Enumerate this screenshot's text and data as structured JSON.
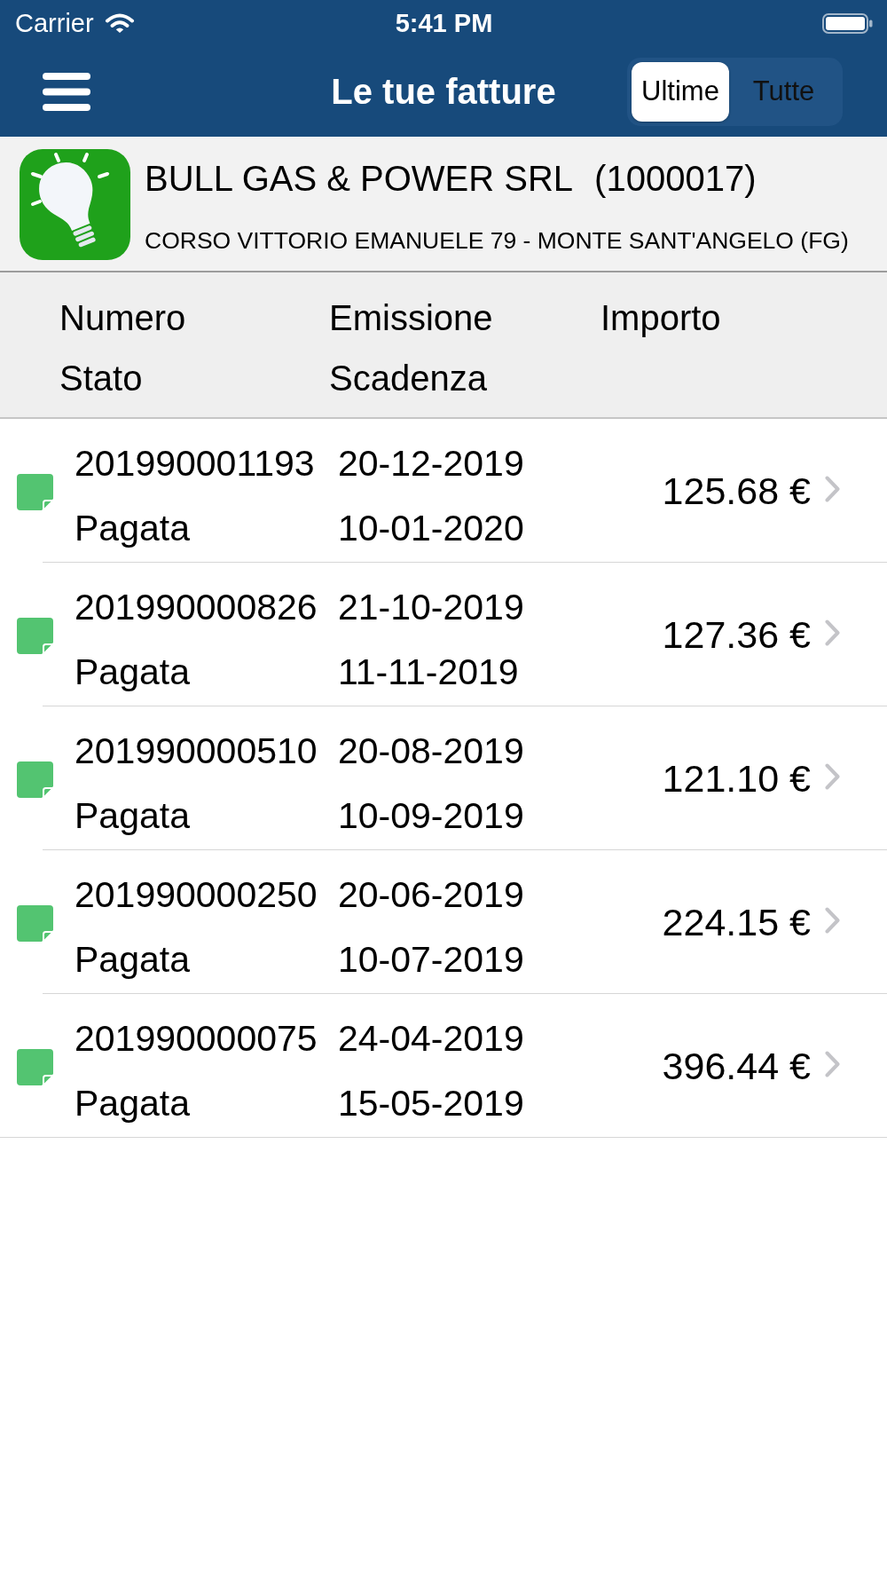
{
  "status_bar": {
    "carrier": "Carrier",
    "time": "5:41 PM"
  },
  "nav_bar": {
    "title": "Le tue fatture",
    "segments": [
      {
        "label": "Ultime",
        "selected": true
      },
      {
        "label": "Tutte",
        "selected": false
      }
    ]
  },
  "customer": {
    "name": "BULL GAS & POWER SRL",
    "code": "(1000017)",
    "address": "CORSO VITTORIO EMANUELE 79 - MONTE SANT'ANGELO (FG)"
  },
  "table": {
    "columns": [
      {
        "lines": [
          "Numero",
          "Stato"
        ]
      },
      {
        "lines": [
          "Emissione",
          "Scadenza"
        ]
      },
      {
        "lines": [
          "Importo"
        ]
      }
    ],
    "rows": [
      {
        "number": "201990001193",
        "status": "Pagata",
        "issued": "20-12-2019",
        "due": "10-01-2020",
        "amount": "125.68 €",
        "color": "#53c471"
      },
      {
        "number": "201990000826",
        "status": "Pagata",
        "issued": "21-10-2019",
        "due": "11-11-2019",
        "amount": "127.36 €",
        "color": "#53c471"
      },
      {
        "number": "201990000510",
        "status": "Pagata",
        "issued": "20-08-2019",
        "due": "10-09-2019",
        "amount": "121.10 €",
        "color": "#53c471"
      },
      {
        "number": "201990000250",
        "status": "Pagata",
        "issued": "20-06-2019",
        "due": "10-07-2019",
        "amount": "224.15 €",
        "color": "#53c471"
      },
      {
        "number": "201990000075",
        "status": "Pagata",
        "issued": "24-04-2019",
        "due": "15-05-2019",
        "amount": "396.44 €",
        "color": "#53c471"
      }
    ]
  }
}
